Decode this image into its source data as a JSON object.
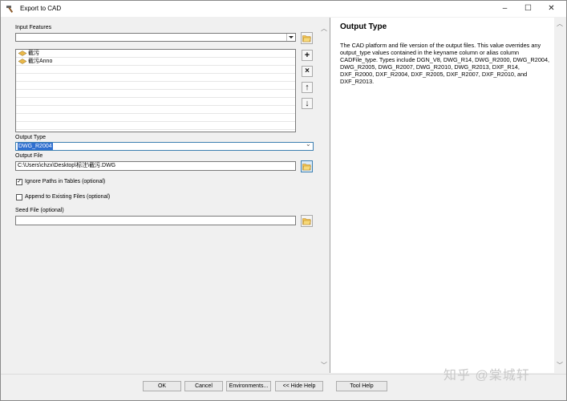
{
  "window": {
    "title": "Export to CAD",
    "controls": {
      "minimize": "–",
      "maximize": "☐",
      "close": "✕"
    }
  },
  "form": {
    "input_features_label": "Input Features",
    "input_features_value": "",
    "features": [
      "截污",
      "截污Anno"
    ],
    "output_type_label": "Output Type",
    "output_type_value": "DWG_R2004",
    "output_file_label": "Output File",
    "output_file_value": "C:\\Users\\chzx\\Desktop\\标注\\截污.DWG",
    "ignore_paths_label": "Ignore Paths in Tables (optional)",
    "ignore_paths_checked": "✓",
    "append_label": "Append to Existing Files (optional)",
    "seed_file_label": "Seed File (optional)",
    "seed_file_value": "",
    "side_buttons": {
      "add": "+",
      "remove": "×",
      "up": "↑",
      "down": "↓"
    }
  },
  "help": {
    "title": "Output Type",
    "text": "The CAD platform and file version of the output files. This value overrides any output_type values contained in the keyname column or alias column CADFile_type. Types include DGN_V8, DWG_R14, DWG_R2000, DWG_R2004, DWG_R2005, DWG_R2007, DWG_R2010, DWG_R2013, DXF_R14, DXF_R2000, DXF_R2004, DXF_R2005, DXF_R2007, DXF_R2010, and DXF_R2013."
  },
  "buttons": {
    "ok": "OK",
    "cancel": "Cancel",
    "environments": "Environments...",
    "hide_help": "<< Hide Help",
    "tool_help": "Tool Help"
  },
  "watermark": "知乎 @棠城轩",
  "colors": {
    "selection": "#2f6fd0",
    "accent_border": "#3c7fb1"
  }
}
